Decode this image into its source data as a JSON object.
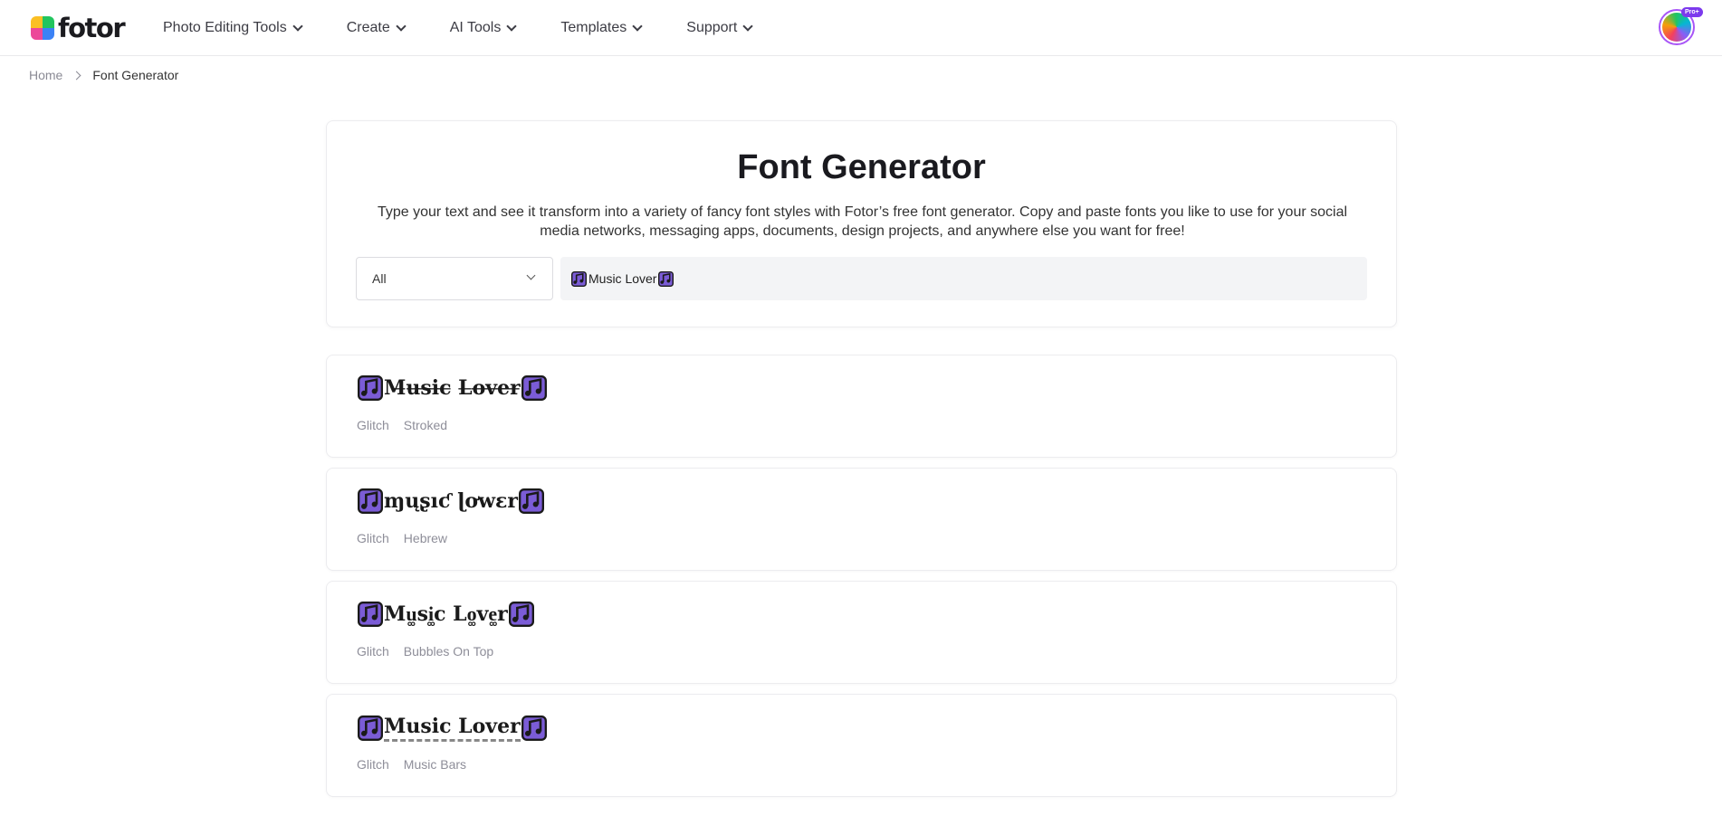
{
  "header": {
    "logo_text": "fotor",
    "nav": [
      {
        "label": "Photo Editing Tools"
      },
      {
        "label": "Create"
      },
      {
        "label": "AI Tools"
      },
      {
        "label": "Templates"
      },
      {
        "label": "Support"
      }
    ],
    "pro_badge": "Pro+"
  },
  "breadcrumb": {
    "home": "Home",
    "current": "Font Generator"
  },
  "hero": {
    "title": "Font Generator",
    "description": "Type your text and see it transform into a variety of fancy font styles with Fotor’s free font generator. Copy and paste fonts you like to use for your social media networks, messaging apps, documents, design projects, and anywhere else you want for free!",
    "category_select": "All",
    "input_value": "Music Lover"
  },
  "results": [
    {
      "text": "M̶u̶s̶i̶c̶ L̶o̶v̶e̶r̶",
      "tags": [
        "Glitch",
        "Stroked"
      ]
    },
    {
      "text": "ɱųʂıƈ ɭơwɛr",
      "tags": [
        "Glitch",
        "Hebrew"
      ]
    },
    {
      "text": "Mu͚si͚c Lo͚ve͚r",
      "tags": [
        "Glitch",
        "Bubbles On Top"
      ]
    },
    {
      "text": "Music Lover",
      "tags": [
        "Glitch",
        "Music Bars"
      ]
    }
  ],
  "colors": {
    "accent": "#7c3aed",
    "note_fill": "#7b5cd6",
    "tag_text": "#8e8e99"
  },
  "icons": {
    "note": "musical-notes-icon",
    "chevron": "chevron-down-icon"
  }
}
